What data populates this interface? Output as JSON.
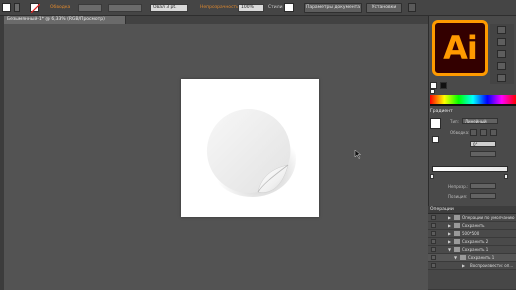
{
  "control_bar": {
    "fill_label": "",
    "stroke_label": "Обводка",
    "brush_value": "Овал 3 pt.",
    "opacity_label": "Непрозрачность",
    "opacity_value": "100%",
    "styles_label": "Стили",
    "doc_settings_button": "Параметры документа",
    "preferences_button": "Установки"
  },
  "document_tab": {
    "title": "Безымянный-1* @ 6,33% (RGB/Просмотр)"
  },
  "logo": {
    "text": "Ai",
    "brand_color": "#ff9a00",
    "bg_color": "#330000"
  },
  "gradient_panel": {
    "title": "Градиент",
    "type_label": "Тип:",
    "type_value": "Линейный",
    "stroke_label": "Обводка:",
    "angle_value": "0°",
    "opacity_label": "Непрозр.:",
    "position_label": "Позиция:"
  },
  "layers_panel": {
    "title": "Операции",
    "rows": [
      {
        "name": "Операции по умолчанию",
        "icon": "folder-icon"
      },
      {
        "name": "Сохранить",
        "icon": "folder-icon"
      },
      {
        "name": "500*500",
        "icon": "folder-icon"
      },
      {
        "name": "Сохранить 2",
        "icon": "folder-icon"
      },
      {
        "name": "Сохранить 1",
        "icon": "folder-icon"
      },
      {
        "name": "Сохранить 1",
        "icon": "folder-icon"
      },
      {
        "name": "Воспроизвести: оп...",
        "icon": "play-icon"
      }
    ]
  }
}
